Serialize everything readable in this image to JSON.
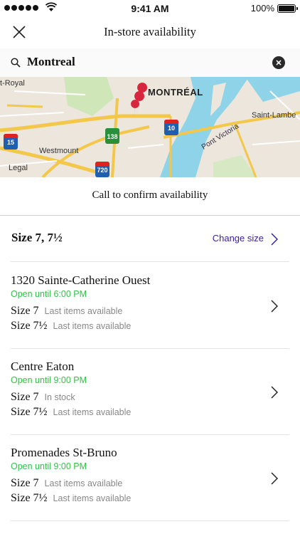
{
  "status_bar": {
    "time": "9:41 AM",
    "battery": "100%"
  },
  "header": {
    "title": "In-store availability"
  },
  "search": {
    "value": "Montreal"
  },
  "map": {
    "labels": {
      "city": "MONTRÉAL",
      "royal": "t-Royal",
      "westmount": "Westmount",
      "legal": "Legal",
      "saint_lambert": "Saint-Lambe",
      "pont_victoria": "Pont Victoria"
    },
    "highways": [
      "15",
      "138",
      "10",
      "720"
    ]
  },
  "call_text": "Call to confirm availability",
  "size_selector": {
    "label": "Size 7, 7½",
    "change_label": "Change size"
  },
  "stores": [
    {
      "name": "1320 Sainte-Catherine Ouest",
      "hours": "Open until 6:00 PM",
      "sizes": [
        {
          "size": "Size 7",
          "status": "Last items available"
        },
        {
          "size": "Size 7½",
          "status": "Last items available"
        }
      ]
    },
    {
      "name": "Centre Eaton",
      "hours": "Open until 9:00 PM",
      "sizes": [
        {
          "size": "Size 7",
          "status": "In stock"
        },
        {
          "size": "Size 7½",
          "status": "Last items available"
        }
      ]
    },
    {
      "name": "Promenades St-Bruno",
      "hours": "Open until 9:00 PM",
      "sizes": [
        {
          "size": "Size 7",
          "status": "Last items available"
        },
        {
          "size": "Size 7½",
          "status": "Last items available"
        }
      ]
    }
  ],
  "colors": {
    "open": "#35c04a",
    "link": "#3a1fa0",
    "water": "#8fd3e8",
    "road": "#f3c74a"
  }
}
